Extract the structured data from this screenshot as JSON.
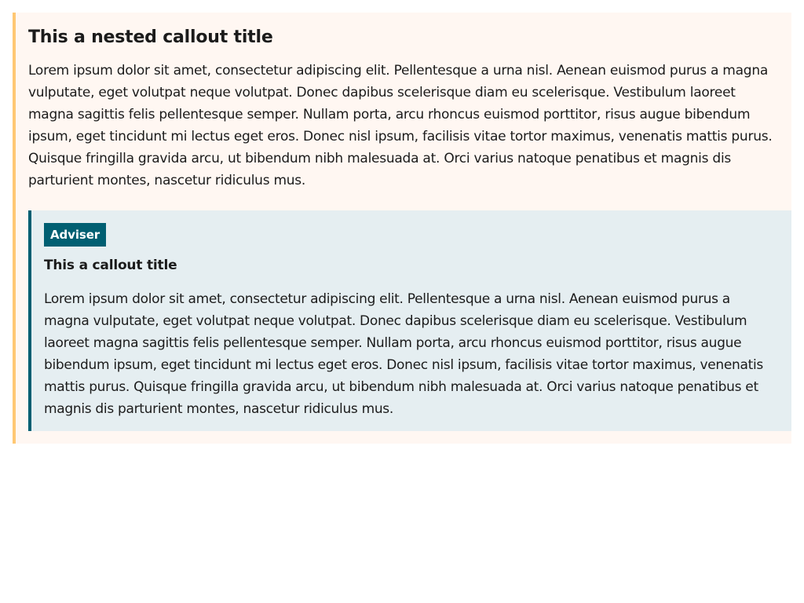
{
  "outer_callout": {
    "title": "This a nested callout title",
    "body": "Lorem ipsum dolor sit amet, consectetur adipiscing elit. Pellentesque a urna nisl. Aenean euismod purus a magna vulputate, eget volutpat neque volutpat. Donec dapibus scelerisque diam eu scelerisque. Vestibulum laoreet magna sagittis felis pellentesque semper. Nullam porta, arcu rhoncus euismod porttitor, risus augue bibendum ipsum, eget tincidunt mi lectus eget eros. Donec nisl ipsum, facilisis vitae tortor maximus, venenatis mattis purus. Quisque fringilla gravida arcu, ut bibendum nibh malesuada at. Orci varius natoque penatibus et magnis dis parturient montes, nascetur ridiculus mus.",
    "accent_color": "#ffc874",
    "background_color": "#fff7f2"
  },
  "inner_callout": {
    "badge": "Adviser",
    "title": "This a callout title",
    "body": "Lorem ipsum dolor sit amet, consectetur adipiscing elit. Pellentesque a urna nisl. Aenean euismod purus a magna vulputate, eget volutpat neque volutpat. Donec dapibus scelerisque diam eu scelerisque. Vestibulum laoreet magna sagittis felis pellentesque semper. Nullam porta, arcu rhoncus euismod porttitor, risus augue bibendum ipsum, eget tincidunt mi lectus eget eros. Donec nisl ipsum, facilisis vitae tortor maximus, venenatis mattis purus. Quisque fringilla gravida arcu, ut bibendum nibh malesuada at. Orci varius natoque penatibus et magnis dis parturient montes, nascetur ridiculus mus.",
    "accent_color": "#005f72",
    "background_color": "#e5eef1"
  }
}
